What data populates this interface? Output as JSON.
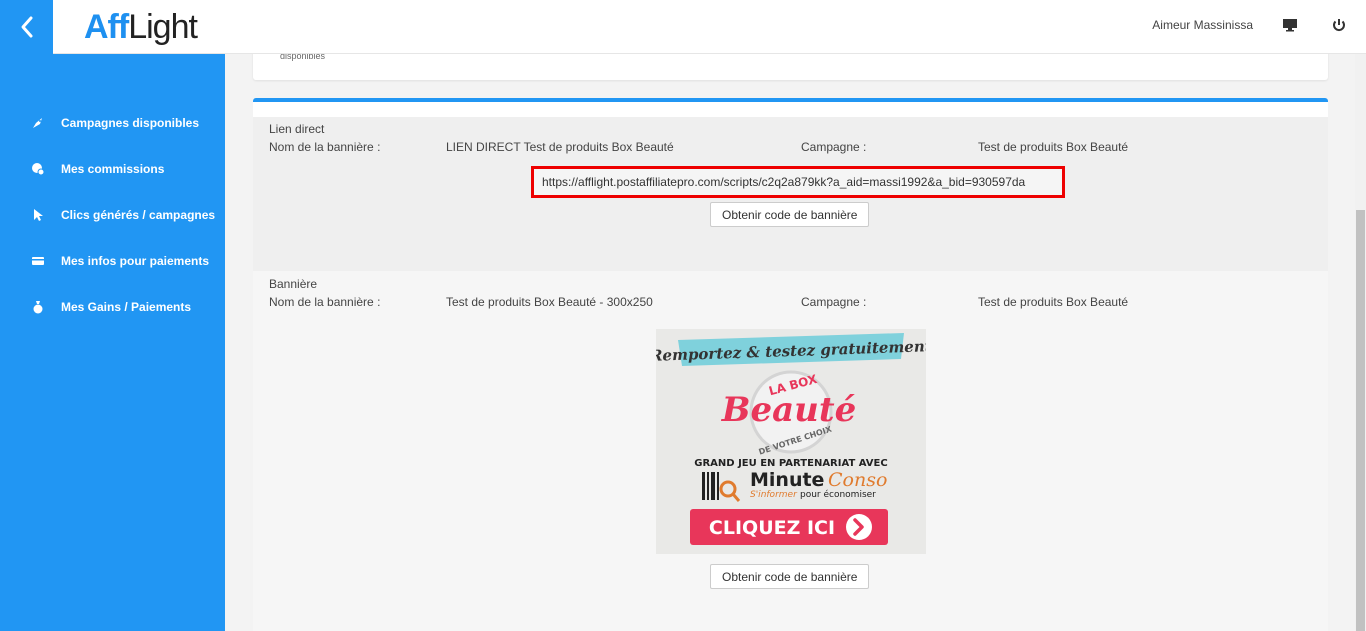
{
  "app": {
    "logo_aff": "Aff",
    "logo_light": "Light",
    "username": "Aimeur Massinissa"
  },
  "sidebar": {
    "items": [
      {
        "label": "Campagnes disponibles",
        "icon": "rocket-icon"
      },
      {
        "label": "Mes commissions",
        "icon": "coins-icon"
      },
      {
        "label": "Clics générés / campagnes",
        "icon": "cursor-icon"
      },
      {
        "label": "Mes infos pour paiements",
        "icon": "credit-card-icon"
      },
      {
        "label": "Mes Gains / Paiements",
        "icon": "money-bag-icon"
      }
    ]
  },
  "top_card": {
    "text": "disponibles"
  },
  "direct_link": {
    "type_label": "Lien direct",
    "banner_name_label": "Nom de la bannière :",
    "banner_name": "LIEN DIRECT Test de produits Box Beauté",
    "campaign_label": "Campagne :",
    "campaign": "Test de produits Box Beauté",
    "url": "https://afflight.postaffiliatepro.com/scripts/c2q2a879kk?a_aid=massi1992&a_bid=930597da",
    "button_label": "Obtenir code de bannière"
  },
  "banner": {
    "type_label": "Bannière",
    "banner_name_label": "Nom de la bannière :",
    "banner_name": "Test de produits Box Beauté - 300x250",
    "campaign_label": "Campagne :",
    "campaign": "Test de produits Box Beauté",
    "button_label": "Obtenir code de bannière",
    "image": {
      "headline": "Remportez & testez gratuitement",
      "box_top": "LA BOX",
      "box_main": "Beauté",
      "box_bottom": "DE VOTRE CHOIX",
      "partner_line": "GRAND JEU EN PARTENARIAT AVEC",
      "brand_minute": "Minute",
      "brand_conso": "Conso",
      "tagline_a": "S'informer",
      "tagline_b": "pour économiser",
      "cta": "CLIQUEZ ICI"
    }
  },
  "colors": {
    "primary": "#2196f3",
    "highlight": "#e00000",
    "cta": "#e8365a"
  }
}
